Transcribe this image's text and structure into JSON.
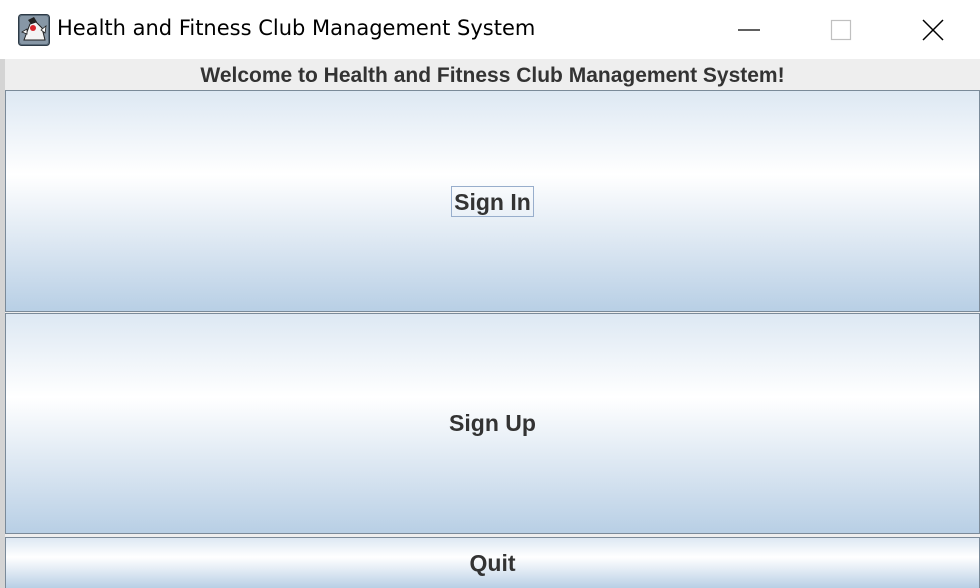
{
  "window": {
    "title": "Health and Fitness Club Management System",
    "app_icon": "java-duke-icon",
    "controls": {
      "minimize_icon": "minimize-icon",
      "maximize_icon": "maximize-icon",
      "close_icon": "close-icon"
    }
  },
  "main": {
    "welcome_text": "Welcome to Health and Fitness Club Management System!",
    "buttons": {
      "sign_in": "Sign In",
      "sign_up": "Sign Up",
      "quit": "Quit"
    }
  },
  "colors": {
    "button_gradient_light": "#ffffff",
    "button_gradient_dark": "#b8cfe5",
    "text": "#333333",
    "focus_ring": "#98aecc"
  }
}
